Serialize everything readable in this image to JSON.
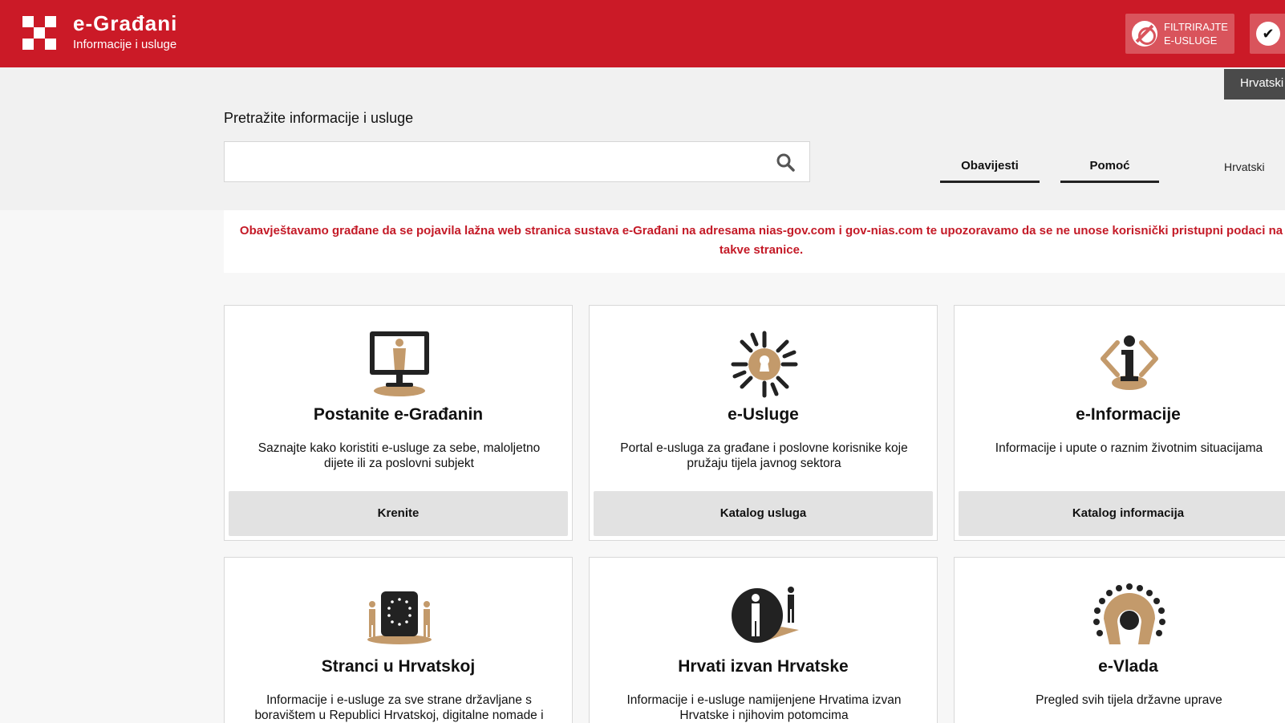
{
  "header": {
    "title": "e-Građani",
    "subtitle": "Informacije i usluge",
    "filter_button": "FILTRIRAJTE\nE-USLUGE",
    "filter_line1": "FILTRIRAJTE",
    "filter_line2": "E-USLUGE",
    "check_icon": "✔"
  },
  "language_tab": "Hrvatski",
  "search": {
    "label": "Pretražite informacije i usluge",
    "value": "",
    "placeholder": ""
  },
  "nav": {
    "notifications": "Obavijesti",
    "help": "Pomoć",
    "language": "Hrvatski"
  },
  "notice": "Obavještavamo građane da se pojavila lažna web stranica sustava e-Građani na adresama nias-gov.com i gov-nias.com te upozoravamo da se ne unose korisnički pristupni podaci na takve stranice.",
  "cards": [
    {
      "icon": "monitor-person-icon",
      "title": "Postanite e-Građanin",
      "description": "Saznajte kako koristiti e-usluge za sebe, maloljetno dijete ili za poslovni subjekt",
      "button": "Krenite"
    },
    {
      "icon": "keyhole-star-icon",
      "title": "e-Usluge",
      "description": "Portal e-usluga za građane i poslovne korisnike koje pružaju tijela javnog sektora",
      "button": "Katalog usluga"
    },
    {
      "icon": "info-person-icon",
      "title": "e-Informacije",
      "description": "Informacije i upute o raznim životnim situacijama",
      "button": "Katalog informacija"
    },
    {
      "icon": "eu-flag-people-icon",
      "title": "Stranci u Hrvatskoj",
      "description": "Informacije i e-usluge za sve strane državljane s boravištem u Republici Hrvatskoj, digitalne nomade i"
    },
    {
      "icon": "croatians-abroad-icon",
      "title": "Hrvati izvan Hrvatske",
      "description": "Informacije i e-usluge namijenjene Hrvatima izvan Hrvatske i njihovim potomcima"
    },
    {
      "icon": "government-circle-icon",
      "title": "e-Vlada",
      "description": "Pregled svih tijela državne uprave"
    }
  ],
  "colors": {
    "brand_red": "#cb1a27",
    "accent_tan": "#c39a6b",
    "dark": "#222222"
  }
}
